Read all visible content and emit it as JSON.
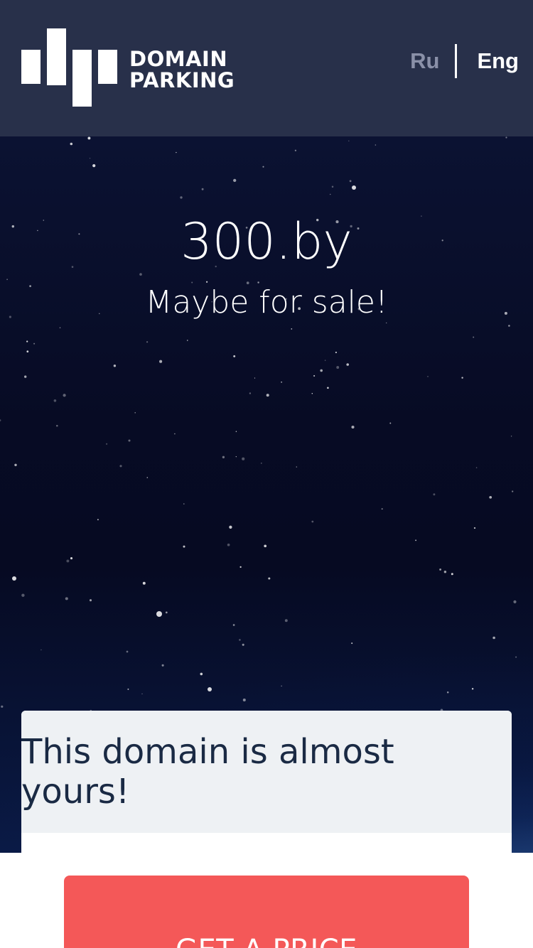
{
  "header": {
    "logo_text_line1": "DOMAIN",
    "logo_text_line2": "PARKING",
    "lang_ru": "Ru",
    "lang_en": "Eng"
  },
  "hero": {
    "domain": "300.by",
    "subtitle": "Maybe for sale!"
  },
  "card": {
    "title": "This domain is almost yours!",
    "button_label": "GET A PRICE"
  },
  "colors": {
    "header_bg": "#28304a",
    "button_bg": "#f45858",
    "card_head_bg": "#eef1f4",
    "lang_inactive": "#8a90a8"
  }
}
